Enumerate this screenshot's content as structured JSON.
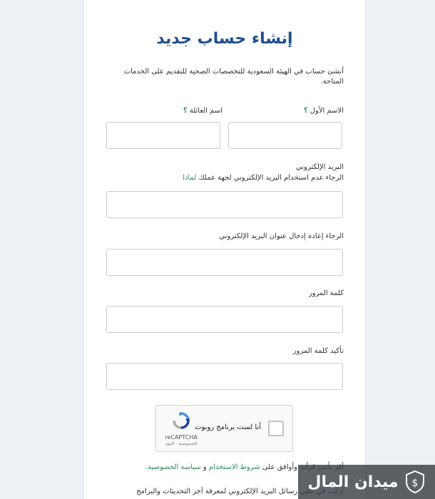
{
  "form": {
    "title": "إنشاء حساب جديد",
    "intro": "أنشئ حساب في الهيئة السعودية للتخصصات الصحية للتقديم على الخدمات المتاحة.",
    "first_name_label": "الاسم الأول",
    "last_name_label": "اسم العائلة",
    "help_mark": "؟",
    "email_label": "البريد الإلكتروني",
    "email_hint": "الرجاء عدم استخدام البريد الإلكتروني لجهة عملك",
    "email_hint_link": "لماذا",
    "email_confirm_label": "الرجاء إعادة إدخال عنوان البريد الإلكتروني",
    "password_label": "كلمة المرور",
    "password_confirm_label": "تأكيد كلمة المرور"
  },
  "captcha": {
    "label": "أنا لست برنامج روبوت",
    "brand": "reCAPTCHA",
    "privacy": "الخصوصية - البنود"
  },
  "terms": {
    "prefix": "أقر بأنني قرأت وأوافق على",
    "terms_link": "شروط الاستخدام",
    "and": "و",
    "privacy_link": "سياسة الخصوصية."
  },
  "newsletter": {
    "text": "أرغب في تلقي رسائل البريد الإلكتروني لمعرفة آخر التحديثات والبرامج"
  },
  "watermark": {
    "text": "ميدان المال"
  },
  "colors": {
    "title": "#1f4e8c",
    "link": "#2e8b57"
  }
}
